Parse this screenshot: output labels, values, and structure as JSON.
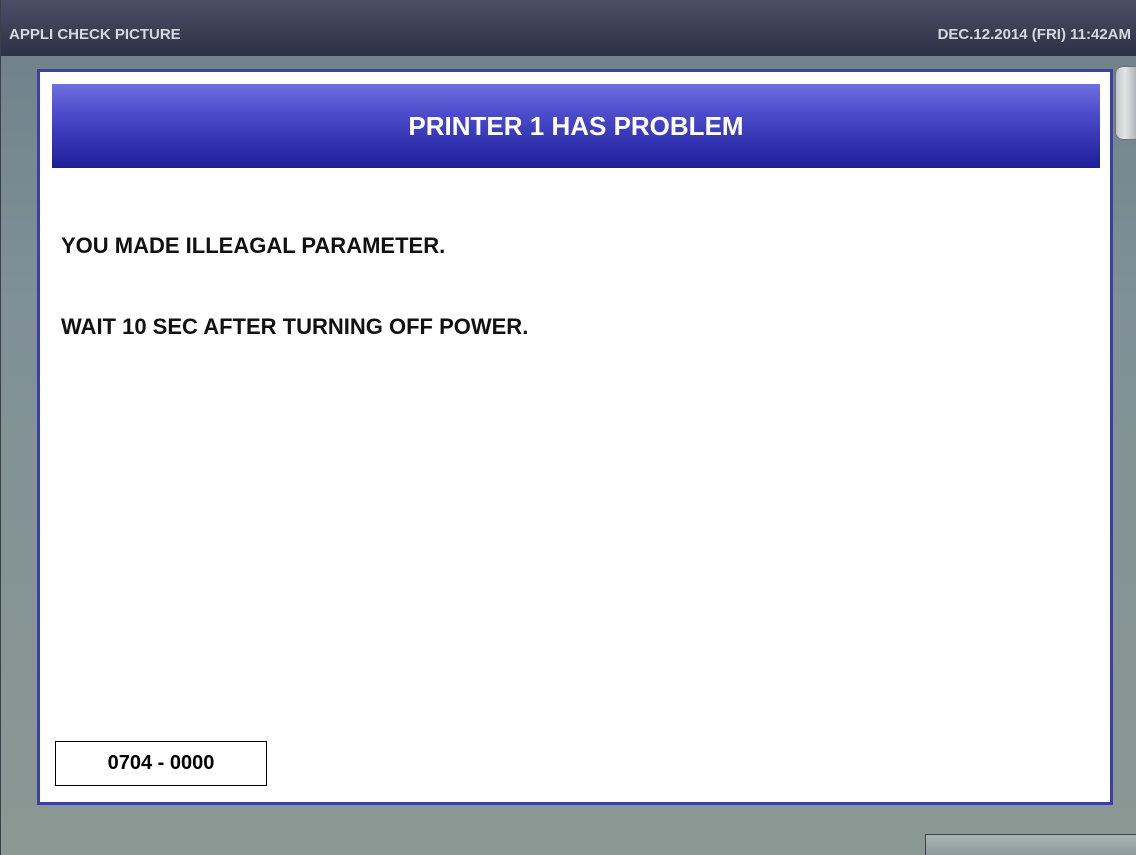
{
  "titlebar": {
    "app_title": "APPLI CHECK PICTURE",
    "datetime": "DEC.12.2014 (FRI)  11:42AM"
  },
  "dialog": {
    "header": "PRINTER 1 HAS PROBLEM",
    "messages": [
      "YOU MADE ILLEAGAL PARAMETER.",
      "WAIT 10 SEC AFTER TURNING OFF POWER."
    ],
    "error_code": "0704 - 0000"
  },
  "colors": {
    "header_blue": "#3b3fa8",
    "titlebar": "#2e3144",
    "background": "#7f9096"
  }
}
